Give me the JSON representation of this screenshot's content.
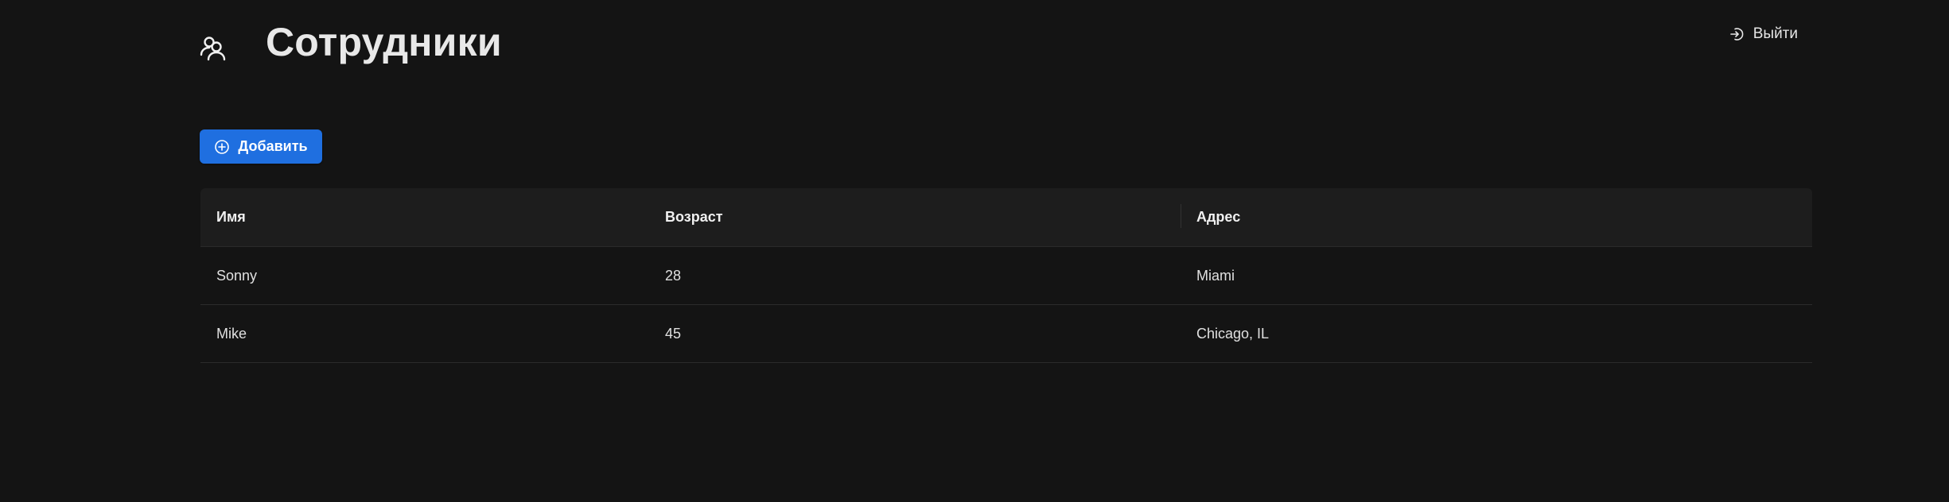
{
  "header": {
    "title": "Сотрудники",
    "icon": "users-icon",
    "logout_label": "Выйти",
    "logout_icon": "logout-icon"
  },
  "toolbar": {
    "add_label": "Добавить",
    "add_icon": "plus-circle-icon",
    "accent_color": "#1f6fe0"
  },
  "table": {
    "columns": [
      "Имя",
      "Возраст",
      "Адрес"
    ],
    "rows": [
      [
        "Sonny",
        "28",
        "Miami"
      ],
      [
        "Mike",
        "45",
        "Chicago, IL"
      ]
    ]
  },
  "theme": {
    "background": "#141414",
    "header_row": "#1d1d1d"
  }
}
